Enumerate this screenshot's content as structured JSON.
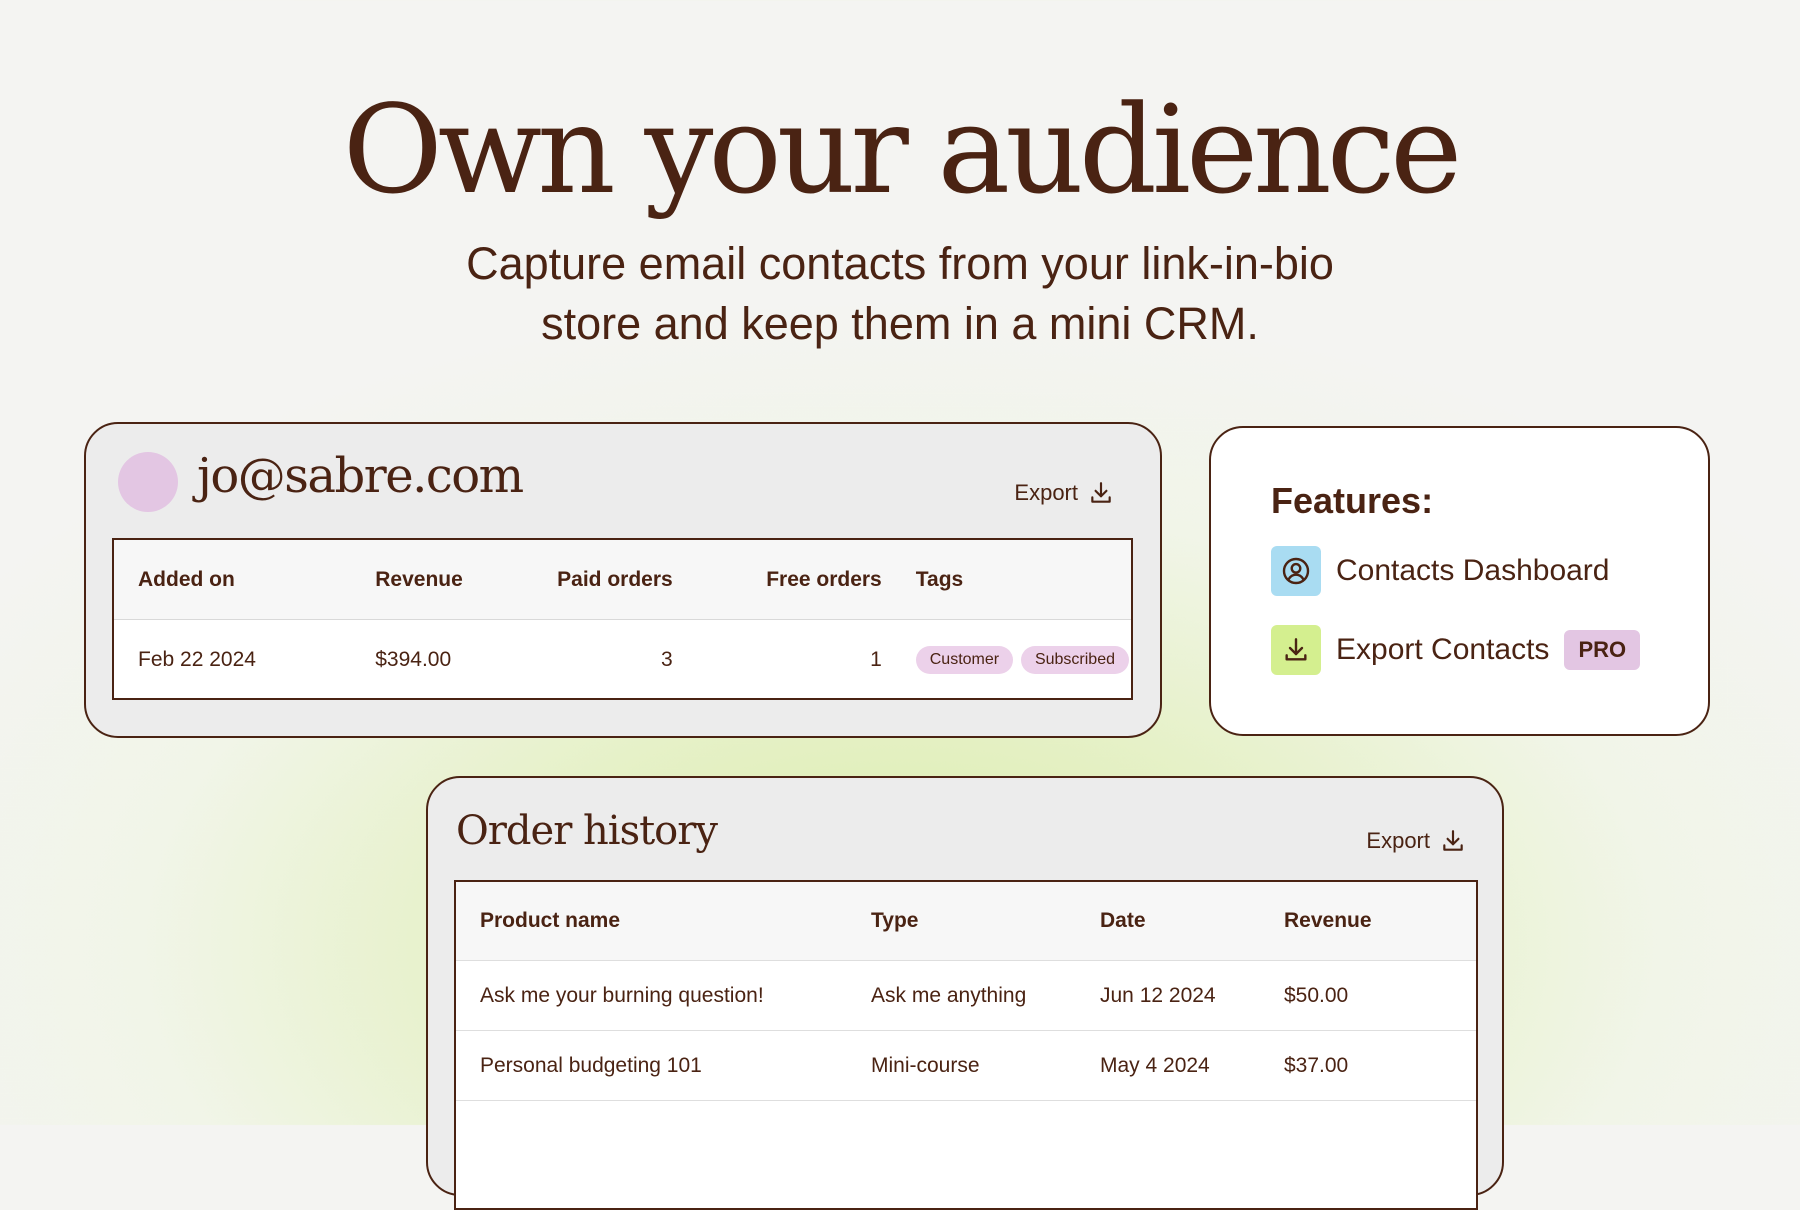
{
  "hero": {
    "title": "Own your audience",
    "subtitle_line1": "Capture email contacts from your link-in-bio",
    "subtitle_line2": "store and keep them in a mini CRM."
  },
  "contact": {
    "email": "jo@sabre.com",
    "export_label": "Export",
    "columns": [
      "Added on",
      "Revenue",
      "Paid orders",
      "Free orders",
      "Tags"
    ],
    "row": {
      "added_on": "Feb 22 2024",
      "revenue": "$394.00",
      "paid_orders": "3",
      "free_orders": "1",
      "tags": [
        "Customer",
        "Subscribed"
      ]
    }
  },
  "features": {
    "title": "Features:",
    "items": [
      {
        "label": "Contacts Dashboard",
        "icon": "contacts-icon",
        "color": "#a9dcf2"
      },
      {
        "label": "Export Contacts",
        "icon": "download-icon",
        "color": "#d4ef8f",
        "badge": "PRO"
      }
    ]
  },
  "orders": {
    "title": "Order history",
    "export_label": "Export",
    "columns": [
      "Product name",
      "Type",
      "Date",
      "Revenue"
    ],
    "rows": [
      {
        "product": "Ask me your burning question!",
        "type": "Ask me anything",
        "date": "Jun 12 2024",
        "revenue": "$50.00"
      },
      {
        "product": "Personal budgeting 101",
        "type": "Mini-course",
        "date": "May 4 2024",
        "revenue": "$37.00"
      }
    ]
  },
  "colors": {
    "text": "#4a2313",
    "tag_bg": "#ecd1ea",
    "avatar": "#e3c6e3"
  }
}
